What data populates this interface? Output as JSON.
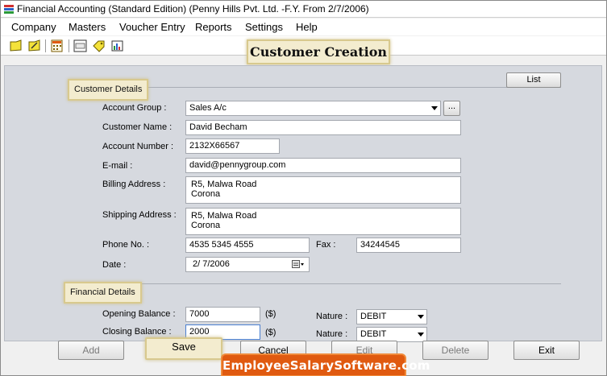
{
  "window": {
    "title": "Financial Accounting (Standard Edition) (Penny Hills Pvt. Ltd. -F.Y. From 2/7/2006)"
  },
  "menu": {
    "items": [
      "Company",
      "Masters",
      "Voucher Entry",
      "Reports",
      "Settings",
      "Help"
    ]
  },
  "toolbar": {
    "icons": [
      "new-icon",
      "edit-icon",
      "calculator-icon",
      "calc-icon",
      "tag-icon",
      "chart-icon"
    ]
  },
  "screen": {
    "title": "Customer Creation"
  },
  "customer_details": {
    "label": "Customer Details",
    "list_button": "List",
    "account_group_label": "Account Group :",
    "account_group_value": "Sales A/c",
    "browse_button": "...",
    "customer_name_label": "Customer Name :",
    "customer_name_value": "David Becham",
    "account_number_label": "Account Number :",
    "account_number_value": "2132X66567",
    "email_label": "E-mail :",
    "email_value": "david@pennygroup.com",
    "billing_label": "Billing Address :",
    "billing_value": "R5, Malwa Road\nCorona",
    "shipping_label": "Shipping Address :",
    "shipping_value": "R5, Malwa Road\nCorona",
    "phone_label": "Phone No. :",
    "phone_value": "4535 5345 4555",
    "fax_label": "Fax :",
    "fax_value": "34244545",
    "date_label": "Date :",
    "date_value": "2/  7/2006"
  },
  "financial_details": {
    "label": "Financial Details",
    "opening_label": "Opening Balance :",
    "opening_value": "7000",
    "opening_unit": "($)",
    "opening_nature_label": "Nature :",
    "opening_nature_value": "DEBIT",
    "closing_label": "Closing Balance :",
    "closing_value": "2000",
    "closing_unit": "($)",
    "closing_nature_label": "Nature :",
    "closing_nature_value": "DEBIT"
  },
  "buttons": {
    "add": "Add",
    "save": "Save",
    "cancel": "Cancel",
    "edit": "Edit",
    "delete": "Delete",
    "exit": "Exit"
  },
  "watermark": "EmployeeSalarySoftware.com",
  "colors": {
    "highlight": "#f3eccf",
    "content_bg": "#d6d9df",
    "watermark_bg": "#e05a10"
  }
}
